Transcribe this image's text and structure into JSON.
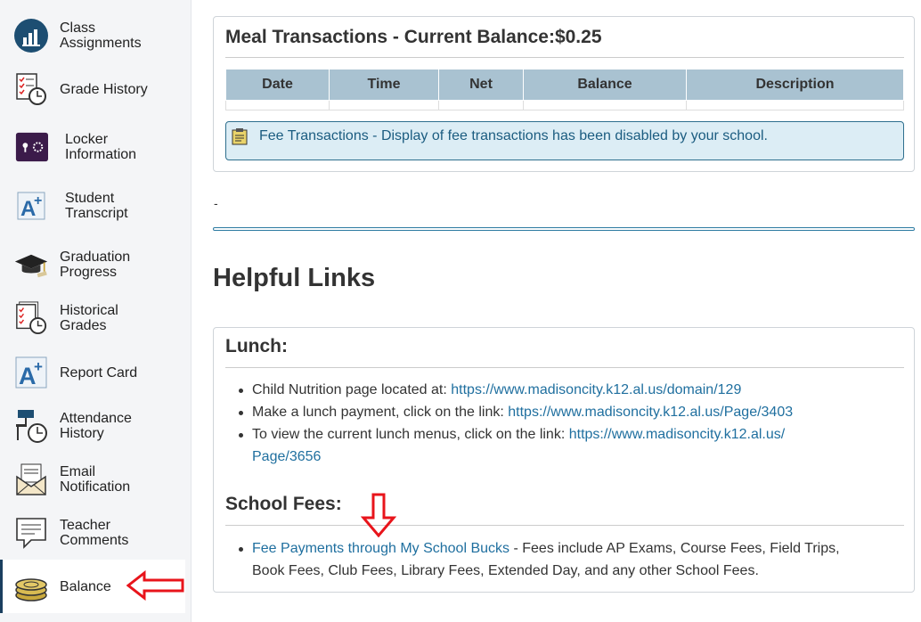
{
  "sidebar": {
    "items": [
      {
        "label": "Class\nAssignments",
        "icon": "class-assignments-icon"
      },
      {
        "label": "Grade History",
        "icon": "grade-history-icon"
      },
      {
        "label": "Locker\nInformation",
        "icon": "locker-icon"
      },
      {
        "label": "Student\nTranscript",
        "icon": "transcript-icon"
      },
      {
        "label": "Graduation\nProgress",
        "icon": "graduation-cap-icon"
      },
      {
        "label": "Historical\nGrades",
        "icon": "historical-grades-icon"
      },
      {
        "label": "Report Card",
        "icon": "report-card-icon"
      },
      {
        "label": "Attendance\nHistory",
        "icon": "attendance-icon"
      },
      {
        "label": "Email\nNotification",
        "icon": "email-icon"
      },
      {
        "label": "Teacher\nComments",
        "icon": "comment-icon"
      },
      {
        "label": "Balance",
        "icon": "coins-icon"
      }
    ]
  },
  "meal": {
    "title": "Meal Transactions - Current Balance:$0.25",
    "columns": [
      "Date",
      "Time",
      "Net",
      "Balance",
      "Description"
    ],
    "alert": "Fee Transactions - Display of fee transactions has been disabled by your school."
  },
  "separator_text": "-",
  "helpful": {
    "heading": "Helpful Links",
    "lunch_title": "Lunch:",
    "lunch_items": [
      {
        "text": "Child Nutrition page located at: ",
        "link": "https://www.madisoncity.k12.al.us/domain/129"
      },
      {
        "text": "Make a lunch payment, click on the link: ",
        "link": "https://www.madisoncity.k12.al.us/Page/3403"
      },
      {
        "text": "To view the current lunch menus, click on the link: ",
        "link": "https://www.madisoncity.k12.al.us/\nPage/3656"
      }
    ],
    "fees_title": "School Fees:",
    "fee_link": "Fee Payments through My School Bucks",
    "fee_text": " - Fees include AP Exams, Course Fees, Field Trips, Book Fees, Club Fees, Library Fees, Extended Day, and any other School Fees."
  },
  "colors": {
    "accent": "#1f6f9f",
    "header_bg": "#a9c2d1",
    "alert_bg": "#dcedf5",
    "annotation_arrow": "#e8141b"
  }
}
